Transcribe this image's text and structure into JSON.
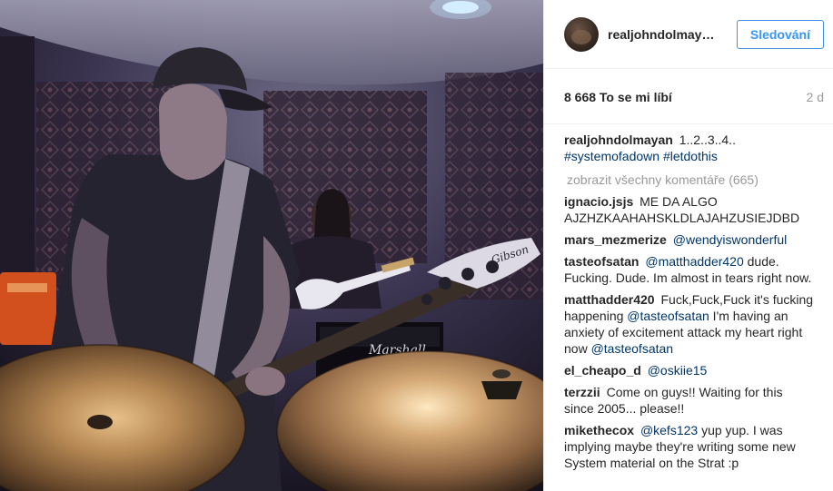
{
  "post": {
    "username": "realjohndolmayan",
    "username_short": "realjohndolmay…",
    "follow_label": "Sledování",
    "likes": "8 668 To se mi líbí",
    "time": "2 d"
  },
  "caption": {
    "user": "realjohndolmayan",
    "text": "1..2..3..4..",
    "hashtags": [
      "#systemofadown",
      "#letdothis"
    ]
  },
  "view_all_label": "zobrazit všechny komentáře (665)",
  "comments": [
    {
      "user": "ignacio.jsjs",
      "parts": [
        {
          "t": "text",
          "v": "ME DA ALGO AJZHZKAAHAHSKLDLAJAHZUSIEJDBD"
        }
      ]
    },
    {
      "user": "mars_mezmerize",
      "parts": [
        {
          "t": "mention",
          "v": "@wendyiswonderful"
        }
      ]
    },
    {
      "user": "tasteofsatan",
      "parts": [
        {
          "t": "mention",
          "v": "@matthadder420"
        },
        {
          "t": "text",
          "v": " dude. Fucking. Dude. Im almost in tears right now."
        }
      ]
    },
    {
      "user": "matthadder420",
      "parts": [
        {
          "t": "text",
          "v": "Fuck,Fuck,Fuck it's fucking happening "
        },
        {
          "t": "mention",
          "v": "@tasteofsatan"
        },
        {
          "t": "text",
          "v": " I'm having an anxiety of excitement attack my heart right now "
        },
        {
          "t": "mention",
          "v": "@tasteofsatan"
        }
      ]
    },
    {
      "user": "el_cheapo_d",
      "parts": [
        {
          "t": "mention",
          "v": "@oskiie15"
        }
      ]
    },
    {
      "user": "terzzii",
      "parts": [
        {
          "t": "text",
          "v": "Come on guys!! Waiting for this since 2005... please!!"
        }
      ]
    },
    {
      "user": "mikethecox",
      "parts": [
        {
          "t": "mention",
          "v": "@kefs123"
        },
        {
          "t": "text",
          "v": " yup yup. I was implying maybe they're writing some new System material on the Strat :p"
        }
      ]
    }
  ],
  "photo": {
    "amp_brand": "Marshall",
    "guitar_brand": "Gibson"
  },
  "colors": {
    "link": "#003569",
    "follow": "#3897f0",
    "muted": "#999999"
  }
}
